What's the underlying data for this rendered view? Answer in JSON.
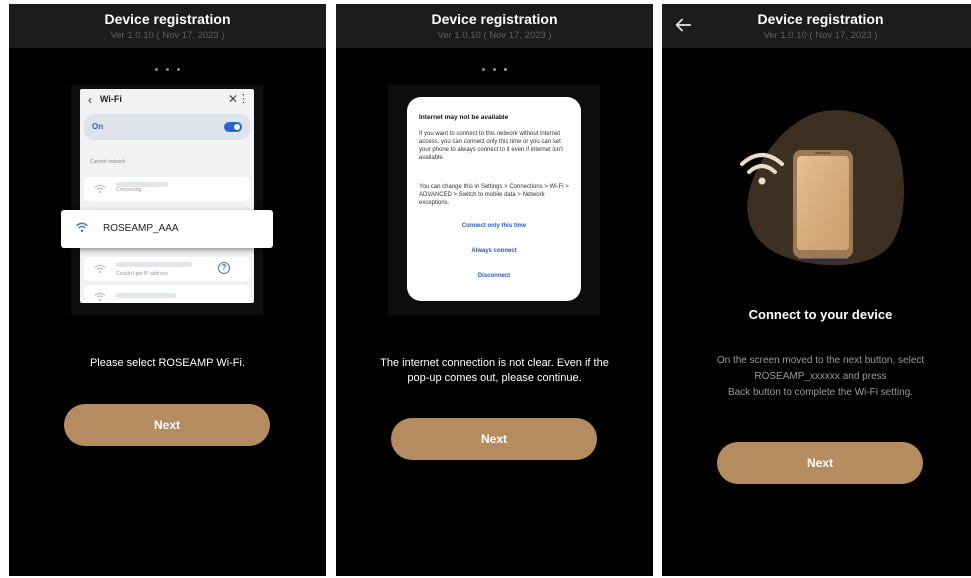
{
  "header": {
    "title": "Device registration",
    "version": "Ver 1.0.10 ( Nov 17, 2023 )"
  },
  "panel1": {
    "wifi_screen": {
      "title": "Wi-Fi",
      "on_label": "On",
      "current_network_label": "Current network",
      "connecting_label": "Connecting...",
      "ip_error_label": "Couldn't get IP address",
      "highlight_network": "ROSEAMP_AAA"
    },
    "caption": "Please select ROSEAMP Wi-Fi.",
    "next_label": "Next"
  },
  "panel2": {
    "popup": {
      "title": "Internet may not be available",
      "body1": "If you want to connect to this network without internet access, you can connect only this time or you can set your phone to always connect to it even if internet isn't available.",
      "body2": "You can change this in Settings > Connections > Wi-Fi > ADVANCED > Switch to mobile data > Network exceptions.",
      "btn_once": "Connect only this time",
      "btn_always": "Always connect",
      "btn_disconnect": "Disconnect"
    },
    "caption_line1": "The internet connection is not clear. Even if the",
    "caption_line2": "pop-up comes out, please continue.",
    "next_label": "Next"
  },
  "panel3": {
    "title": "Connect to your device",
    "instr_line1": "On the screen moved to the next button, select",
    "instr_line2": "ROSEAMP_xxxxxx and press",
    "instr_line3": "Back button to complete the Wi-Fi setting.",
    "next_label": "Next"
  },
  "colors": {
    "accent": "#b58c5f",
    "background": "#000000",
    "header_bg": "#1c1c1c",
    "link_blue": "#2b58c4"
  },
  "icons": [
    "back-arrow-icon",
    "wifi-icon",
    "help-icon",
    "phone-icon"
  ]
}
